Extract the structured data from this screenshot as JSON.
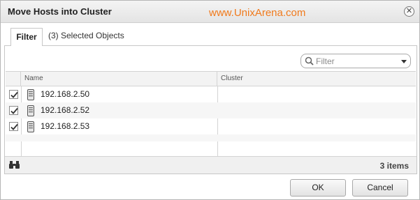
{
  "dialog": {
    "title": "Move Hosts into Cluster",
    "watermark": "www.UnixArena.com",
    "close_icon": "close-icon"
  },
  "tabs": [
    {
      "label": "Filter",
      "active": true
    },
    {
      "label": "(3) Selected Objects",
      "active": false
    }
  ],
  "filter": {
    "placeholder": "Filter",
    "icon": "search-icon"
  },
  "grid": {
    "columns": [
      "Name",
      "Cluster"
    ],
    "rows": [
      {
        "checked": true,
        "name": "192.168.2.50",
        "cluster": "",
        "icon": "host-icon"
      },
      {
        "checked": true,
        "name": "192.168.2.52",
        "cluster": "",
        "icon": "host-icon"
      },
      {
        "checked": true,
        "name": "192.168.2.53",
        "cluster": "",
        "icon": "host-icon"
      }
    ],
    "footer": {
      "count_text": "3 items",
      "icon": "binoculars-icon"
    }
  },
  "buttons": {
    "ok": "OK",
    "cancel": "Cancel"
  },
  "colors": {
    "watermark": "#f07a1c",
    "border": "#c7c7c7"
  }
}
